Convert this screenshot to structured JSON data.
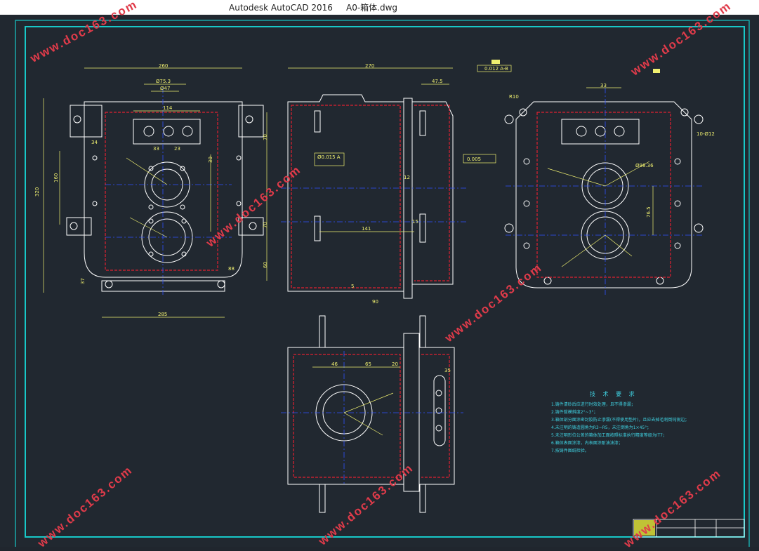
{
  "window": {
    "title": "Autodesk AutoCAD 2016     A0-箱体.dwg"
  },
  "watermark": "www.doc163.com",
  "colors": {
    "background": "#212830",
    "frame": "#18c8c8",
    "outline": "#ffffff",
    "dimension": "#f0f070",
    "hidden": "#e02030",
    "center": "#3050ff",
    "watermark": "#e03b4a"
  },
  "dimensions": {
    "front_width": "260",
    "front_height": "320",
    "bottom_width": "285",
    "phi75": "Ø75.3",
    "phi47": "Ø47",
    "w114": "114",
    "d33a": "33",
    "d23": "23",
    "d34": "34",
    "d160": "160",
    "d70a": "70",
    "d70b": "70",
    "d30": "30",
    "d37": "37",
    "d60": "60",
    "d88": "88",
    "side_width": "270",
    "side_47": "47.5",
    "side_141": "141",
    "side_12": "12",
    "side_15": "15",
    "side_90": "90",
    "side_5": "5",
    "tol_a": "0.012 A-B",
    "tol_b": "Ø0.015 A",
    "tol_c": "0.005",
    "right_33": "33",
    "right_phi": "Ø98.36",
    "right_76": "76.5",
    "right_R10": "R10",
    "right_10phi": "10-Ø12",
    "bottom_46": "46",
    "bottom_65": "65",
    "bottom_20": "20",
    "bottom_35": "35"
  },
  "tech_requirements": {
    "title": "技 术 要 求",
    "items": [
      "1.铸件清砂后应进行时效处理，且不得渗漏；",
      "2.铸件拔模斜度2°~3°；",
      "3.箱体剖分面涂密封胶防止渗漏(不得使用垫片)，且应去掉毛刺倒钝锐边；",
      "4.未注明的铸造圆角为R3~R5，未注倒角为1×45°；",
      "5.未注明形位公差的箱体加工面按照标准执行精度等级为IT7；",
      "6.箱体表面涂漆，内表面涂耐油油漆；",
      "7.按铸件图纸检验。"
    ]
  }
}
